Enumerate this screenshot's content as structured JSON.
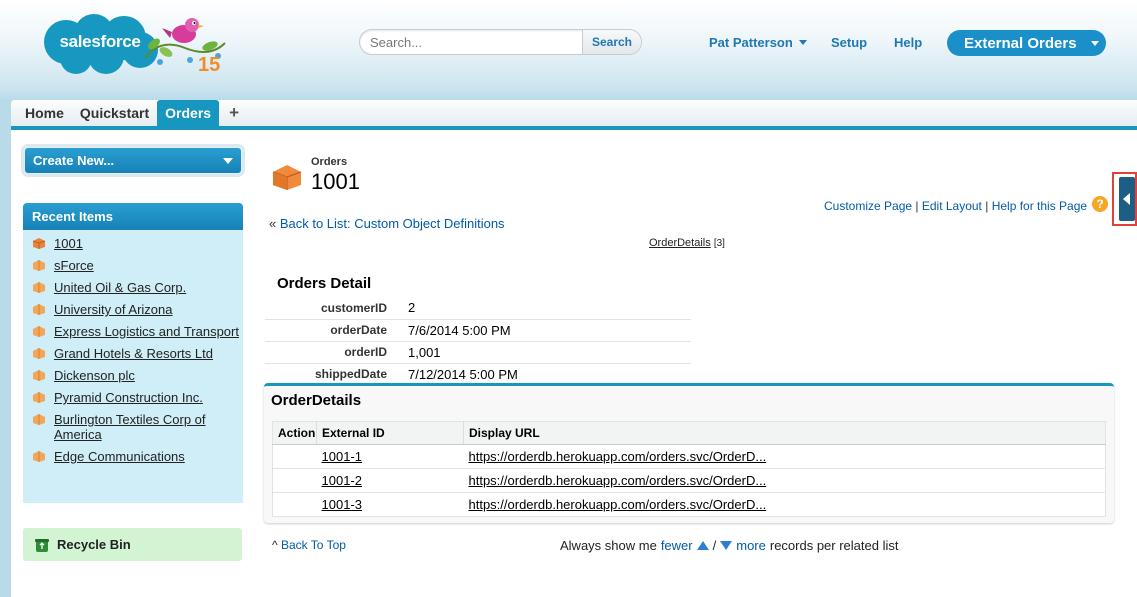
{
  "header": {
    "logo_text": "salesforce",
    "badge_number": "15",
    "search": {
      "placeholder": "Search...",
      "button_label": "Search"
    },
    "user_name": "Pat Patterson",
    "setup_label": "Setup",
    "help_label": "Help",
    "app_name": "External Orders"
  },
  "tabs": [
    {
      "label": "Home"
    },
    {
      "label": "Quickstart"
    },
    {
      "label": "Orders",
      "active": true
    },
    {
      "label": "+"
    }
  ],
  "sidebar": {
    "create_new_label": "Create New...",
    "recent_items_title": "Recent Items",
    "recent_items": [
      {
        "label": "1001"
      },
      {
        "label": "sForce"
      },
      {
        "label": "United Oil & Gas Corp."
      },
      {
        "label": "University of Arizona"
      },
      {
        "label": "Express Logistics and Transport"
      },
      {
        "label": "Grand Hotels & Resorts Ltd"
      },
      {
        "label": "Dickenson plc"
      },
      {
        "label": "Pyramid Construction Inc."
      },
      {
        "label": "Burlington Textiles Corp of America"
      },
      {
        "label": "Edge Communications"
      }
    ],
    "recycle_bin_label": "Recycle Bin"
  },
  "record": {
    "object_type": "Orders",
    "name": "1001",
    "customize_page": "Customize Page",
    "edit_layout": "Edit Layout",
    "help_for_page": "Help for this Page",
    "back_to_list": "Back to List: Custom Object Definitions",
    "related_link": "OrderDetails",
    "related_count": "[3]",
    "detail_title": "Orders Detail",
    "fields": [
      {
        "label": "customerID",
        "value": "2"
      },
      {
        "label": "orderDate",
        "value": "7/6/2014 5:00 PM"
      },
      {
        "label": "orderID",
        "value": "1,001"
      },
      {
        "label": "shippedDate",
        "value": "7/12/2014 5:00 PM"
      }
    ]
  },
  "order_details": {
    "title": "OrderDetails",
    "columns": [
      "Action",
      "External ID",
      "Display URL"
    ],
    "rows": [
      {
        "external_id": "1001-1",
        "url": "https://orderdb.herokuapp.com/orders.svc/OrderD..."
      },
      {
        "external_id": "1001-2",
        "url": "https://orderdb.herokuapp.com/orders.svc/OrderD..."
      },
      {
        "external_id": "1001-3",
        "url": "https://orderdb.herokuapp.com/orders.svc/OrderD..."
      }
    ]
  },
  "footer": {
    "back_to_top": "Back To Top",
    "always_show_me": "Always show me",
    "fewer": "fewer",
    "separator": "/",
    "more": "more",
    "records_text": "records per related list"
  }
}
